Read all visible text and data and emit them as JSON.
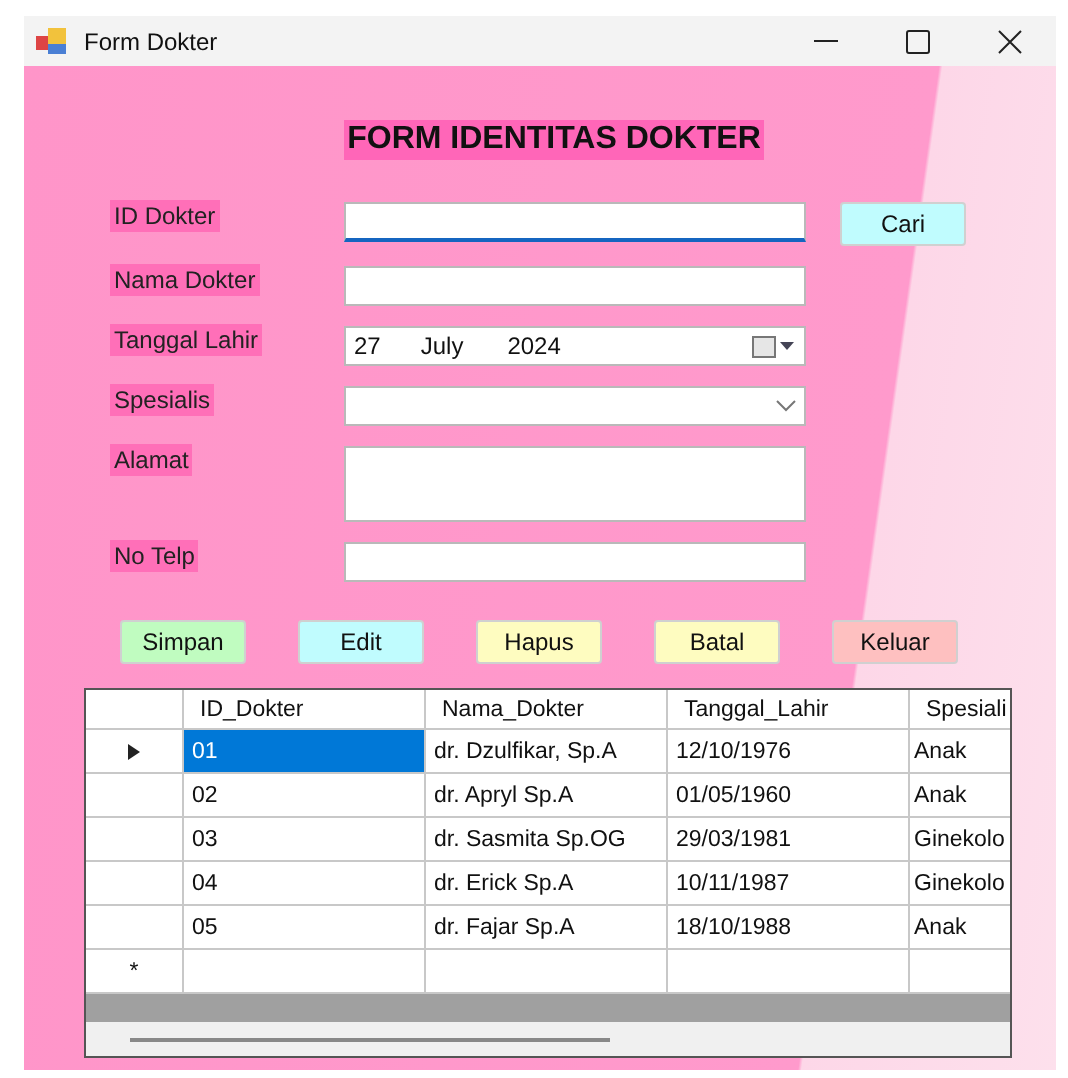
{
  "window": {
    "title": "Form Dokter"
  },
  "heading": "FORM IDENTITAS DOKTER",
  "fields": [
    {
      "kind": "text",
      "label": "ID Dokter",
      "focused": true
    },
    {
      "kind": "text",
      "label": "Nama Dokter",
      "focused": false
    },
    {
      "kind": "date",
      "label": "Tanggal Lahir",
      "day": "27",
      "month": "July",
      "year": "2024",
      "focused": false
    },
    {
      "kind": "combo",
      "label": "Spesialis",
      "focused": false
    },
    {
      "kind": "textarea",
      "label": "Alamat",
      "focused": false
    },
    {
      "kind": "text",
      "label": "No Telp",
      "focused": false
    }
  ],
  "search_button": {
    "label": "Cari",
    "color": "#c0fcfe"
  },
  "buttons": [
    {
      "label": "Simpan",
      "color": "#c0fcc0"
    },
    {
      "label": "Edit",
      "color": "#c0fcfe"
    },
    {
      "label": "Hapus",
      "color": "#fefcc0"
    },
    {
      "label": "Batal",
      "color": "#fefcc0"
    },
    {
      "label": "Keluar",
      "color": "#fec0c0"
    }
  ],
  "table": {
    "columns": [
      "ID_Dokter",
      "Nama_Dokter",
      "Tanggal_Lahir",
      "Spesiali"
    ],
    "rows": [
      {
        "current": true,
        "cells": [
          {
            "text": "01",
            "selected": true
          },
          {
            "text": "dr. Dzulfikar, Sp.A",
            "selected": false
          },
          {
            "text": "12/10/1976",
            "selected": false
          },
          {
            "text": "Anak",
            "selected": false
          }
        ]
      },
      {
        "current": false,
        "cells": [
          {
            "text": "02",
            "selected": false
          },
          {
            "text": "dr. Apryl Sp.A",
            "selected": false
          },
          {
            "text": "01/05/1960",
            "selected": false
          },
          {
            "text": "Anak",
            "selected": false
          }
        ]
      },
      {
        "current": false,
        "cells": [
          {
            "text": "03",
            "selected": false
          },
          {
            "text": "dr. Sasmita Sp.OG",
            "selected": false
          },
          {
            "text": "29/03/1981",
            "selected": false
          },
          {
            "text": "Ginekolo",
            "selected": false
          }
        ]
      },
      {
        "current": false,
        "cells": [
          {
            "text": "04",
            "selected": false
          },
          {
            "text": "dr. Erick Sp.A",
            "selected": false
          },
          {
            "text": "10/11/1987",
            "selected": false
          },
          {
            "text": "Ginekolo",
            "selected": false
          }
        ]
      },
      {
        "current": false,
        "cells": [
          {
            "text": "05",
            "selected": false
          },
          {
            "text": "dr. Fajar Sp.A",
            "selected": false
          },
          {
            "text": "18/10/1988",
            "selected": false
          },
          {
            "text": "Anak",
            "selected": false
          }
        ]
      }
    ],
    "new_row_marker": "*"
  }
}
